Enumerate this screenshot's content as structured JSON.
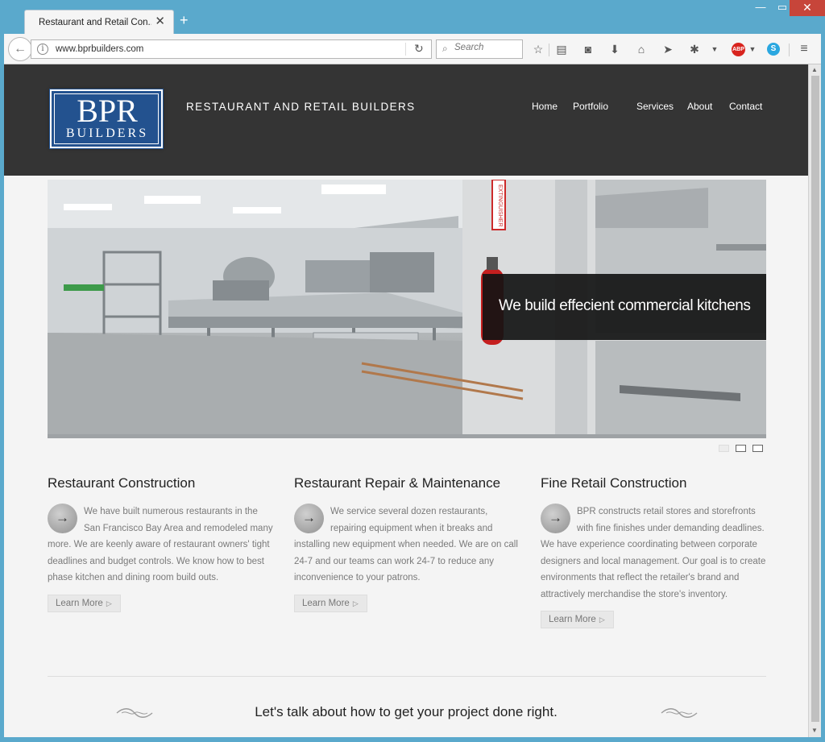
{
  "browser": {
    "tab_title": "Restaurant and Retail Con...",
    "url": "www.bprbuilders.com",
    "search_placeholder": "Search",
    "new_tab_label": "+",
    "tab_close_label": "✕"
  },
  "site": {
    "logo_line1": "BPR",
    "logo_line2": "BUILDERS",
    "tagline": "RESTAURANT AND RETAIL BUILDERS",
    "nav": [
      "Home",
      "Portfolio",
      "Services",
      "About",
      "Contact"
    ]
  },
  "hero": {
    "caption": "We build effecient commercial kitchens",
    "sign_text": "EXTINGUISHER",
    "slides_total": 3,
    "slide_active": 1
  },
  "columns": [
    {
      "title": "Restaurant Construction",
      "body": "We have built numerous restaurants in the San Francisco Bay Area and remodeled many more. We are keenly aware of restaurant owners' tight deadlines and budget controls. We know how to best phase kitchen and dining room build outs.",
      "button": "Learn More"
    },
    {
      "title": "Restaurant Repair & Maintenance",
      "body": "We service several dozen restaurants, repairing equipment when it breaks and installing new equipment when needed. We are on call 24-7 and our teams can work 24-7 to reduce any inconvenience to your patrons.",
      "button": "Learn More"
    },
    {
      "title": "Fine Retail Construction",
      "body": "BPR constructs retail stores and storefronts with fine finishes under demanding deadlines. We have experience coordinating between corporate designers and local management. Our goal is to create environments that reflect the retailer's brand and attractively merchandise the store's inventory.",
      "button": "Learn More"
    }
  ],
  "cta": "Let's talk about how to get your project done right.",
  "icons": {
    "back": "back-arrow-icon",
    "info": "info-icon",
    "reload": "reload-icon",
    "search": "search-icon",
    "star": "bookmark-star-icon",
    "reading": "reading-list-icon",
    "pocket": "pocket-icon",
    "download": "download-icon",
    "home": "home-icon",
    "send": "send-icon",
    "bug": "bug-icon",
    "abp": "adblock-plus-icon",
    "skype": "skype-icon",
    "menu": "hamburger-menu-icon",
    "arrow": "right-arrow-icon"
  },
  "colors": {
    "header_bg": "#343434",
    "logo_blue": "#23528f",
    "chrome_blue": "#5aa9cc"
  }
}
